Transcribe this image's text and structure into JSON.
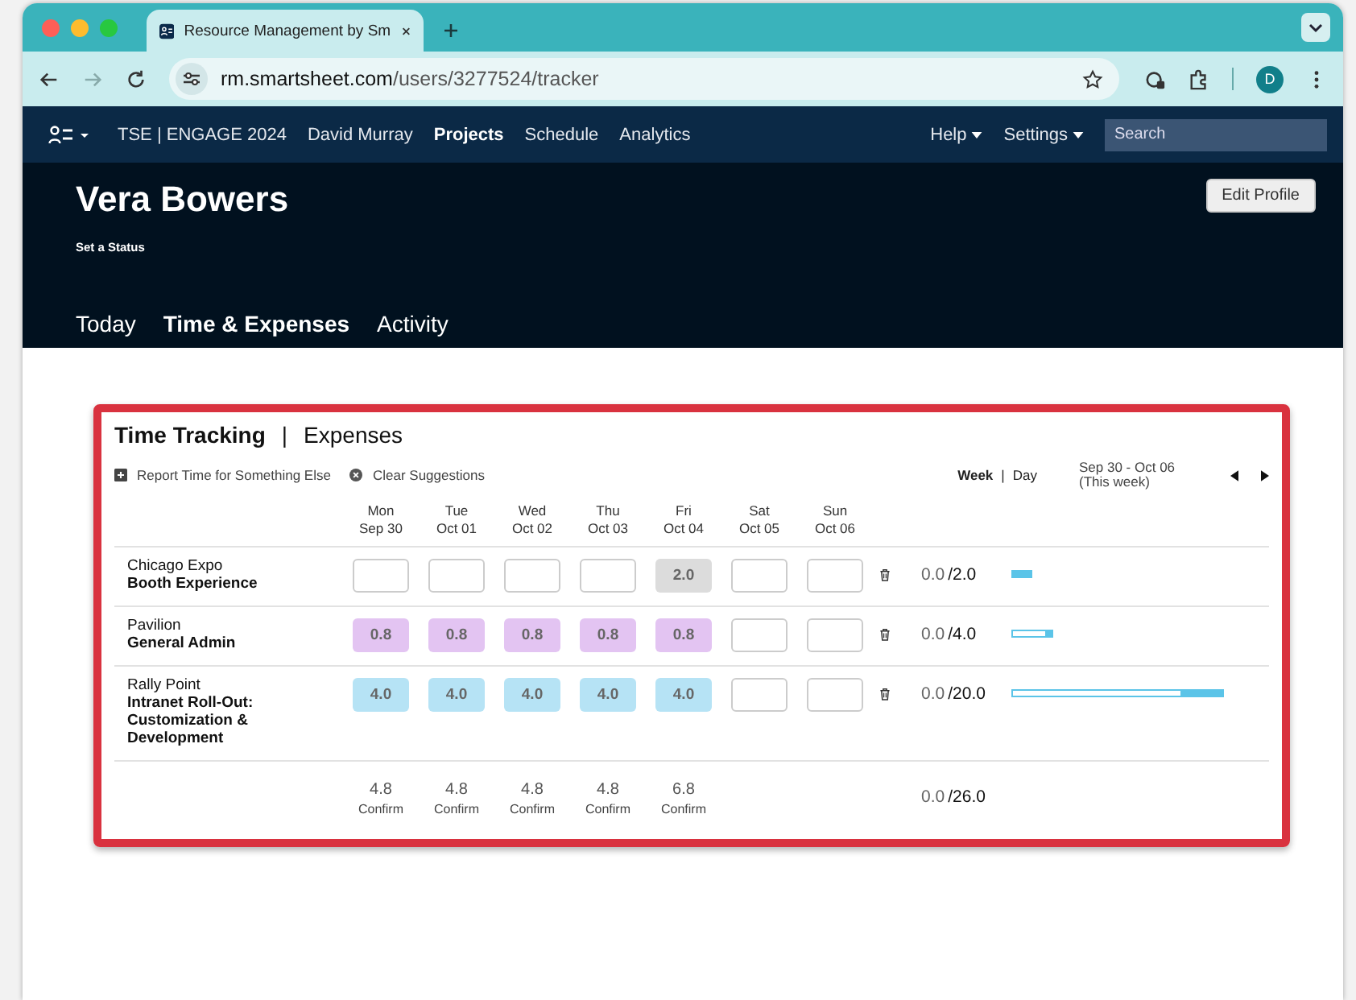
{
  "browser": {
    "tab_title": "Resource Management by Sm",
    "url_host": "rm.smartsheet.com",
    "url_path": "/users/3277524/tracker",
    "profile_initial": "D"
  },
  "nav": {
    "items": [
      {
        "label": "TSE | ENGAGE 2024",
        "selected": false
      },
      {
        "label": "David Murray",
        "selected": false
      },
      {
        "label": "Projects",
        "selected": true
      },
      {
        "label": "Schedule",
        "selected": false
      },
      {
        "label": "Analytics",
        "selected": false
      }
    ],
    "menus": [
      "Help",
      "Settings"
    ],
    "search": {
      "placeholder": "Search"
    }
  },
  "profile": {
    "name": "Vera Bowers",
    "status": "Set a Status",
    "edit_button": "Edit Profile",
    "tabs": [
      {
        "label": "Today",
        "selected": false
      },
      {
        "label": "Time & Expenses",
        "selected": true
      },
      {
        "label": "Activity",
        "selected": false
      }
    ]
  },
  "tracker": {
    "tab_separator": "|",
    "view_separator": "|",
    "tabs": [
      {
        "label": "Time Tracking",
        "selected": true
      },
      {
        "label": "Expenses",
        "selected": false
      }
    ],
    "actions": [
      {
        "label": "Report Time for Something Else",
        "kind": "add"
      },
      {
        "label": "Clear Suggestions",
        "kind": "clear"
      }
    ],
    "view_toggle": [
      {
        "label": "Week",
        "selected": true
      },
      {
        "label": "Day",
        "selected": false
      }
    ],
    "range": [
      "Sep 30 - Oct 06",
      "(This week)"
    ],
    "days": [
      {
        "day": "Mon",
        "date": "Sep 30"
      },
      {
        "day": "Tue",
        "date": "Oct 01"
      },
      {
        "day": "Wed",
        "date": "Oct 02"
      },
      {
        "day": "Thu",
        "date": "Oct 03"
      },
      {
        "day": "Fri",
        "date": "Oct 04"
      },
      {
        "day": "Sat",
        "date": "Oct 05"
      },
      {
        "day": "Sun",
        "date": "Oct 06"
      }
    ],
    "rows": [
      {
        "project": "Chicago Expo",
        "phase": "Booth Experience",
        "reported": "0.0",
        "total": "/2.0",
        "level": 1,
        "cells": [
          {
            "kind": "empty"
          },
          {
            "kind": "empty"
          },
          {
            "kind": "empty"
          },
          {
            "kind": "empty"
          },
          {
            "kind": "suggested",
            "value": "2.0",
            "color": "#dcdcdc"
          },
          {
            "kind": "empty"
          },
          {
            "kind": "empty"
          }
        ]
      },
      {
        "project": "Pavilion",
        "phase": "General Admin",
        "reported": "0.0",
        "total": "/4.0",
        "level": 0.2,
        "cells": [
          {
            "kind": "suggested",
            "value": "0.8",
            "color": "#e3c4f2"
          },
          {
            "kind": "suggested",
            "value": "0.8",
            "color": "#e3c4f2"
          },
          {
            "kind": "suggested",
            "value": "0.8",
            "color": "#e3c4f2"
          },
          {
            "kind": "suggested",
            "value": "0.8",
            "color": "#e3c4f2"
          },
          {
            "kind": "suggested",
            "value": "0.8",
            "color": "#e3c4f2"
          },
          {
            "kind": "empty"
          },
          {
            "kind": "empty"
          }
        ]
      },
      {
        "project": "Rally Point",
        "phase": "Intranet Roll-Out: Customization & Development",
        "reported": "0.0",
        "total": "/20.0",
        "level": 0.2,
        "cells": [
          {
            "kind": "suggested",
            "value": "4.0",
            "color": "#b6e3f5"
          },
          {
            "kind": "suggested",
            "value": "4.0",
            "color": "#b6e3f5"
          },
          {
            "kind": "suggested",
            "value": "4.0",
            "color": "#b6e3f5"
          },
          {
            "kind": "suggested",
            "value": "4.0",
            "color": "#b6e3f5"
          },
          {
            "kind": "suggested",
            "value": "4.0",
            "color": "#b6e3f5"
          },
          {
            "kind": "empty"
          },
          {
            "kind": "empty"
          }
        ]
      }
    ],
    "day_totals": [
      {
        "value": "4.8",
        "action": "Confirm"
      },
      {
        "value": "4.8",
        "action": "Confirm"
      },
      {
        "value": "4.8",
        "action": "Confirm"
      },
      {
        "value": "4.8",
        "action": "Confirm"
      },
      {
        "value": "6.8",
        "action": "Confirm"
      }
    ],
    "grand_total": {
      "reported": "0.0",
      "total": "/26.0"
    }
  }
}
